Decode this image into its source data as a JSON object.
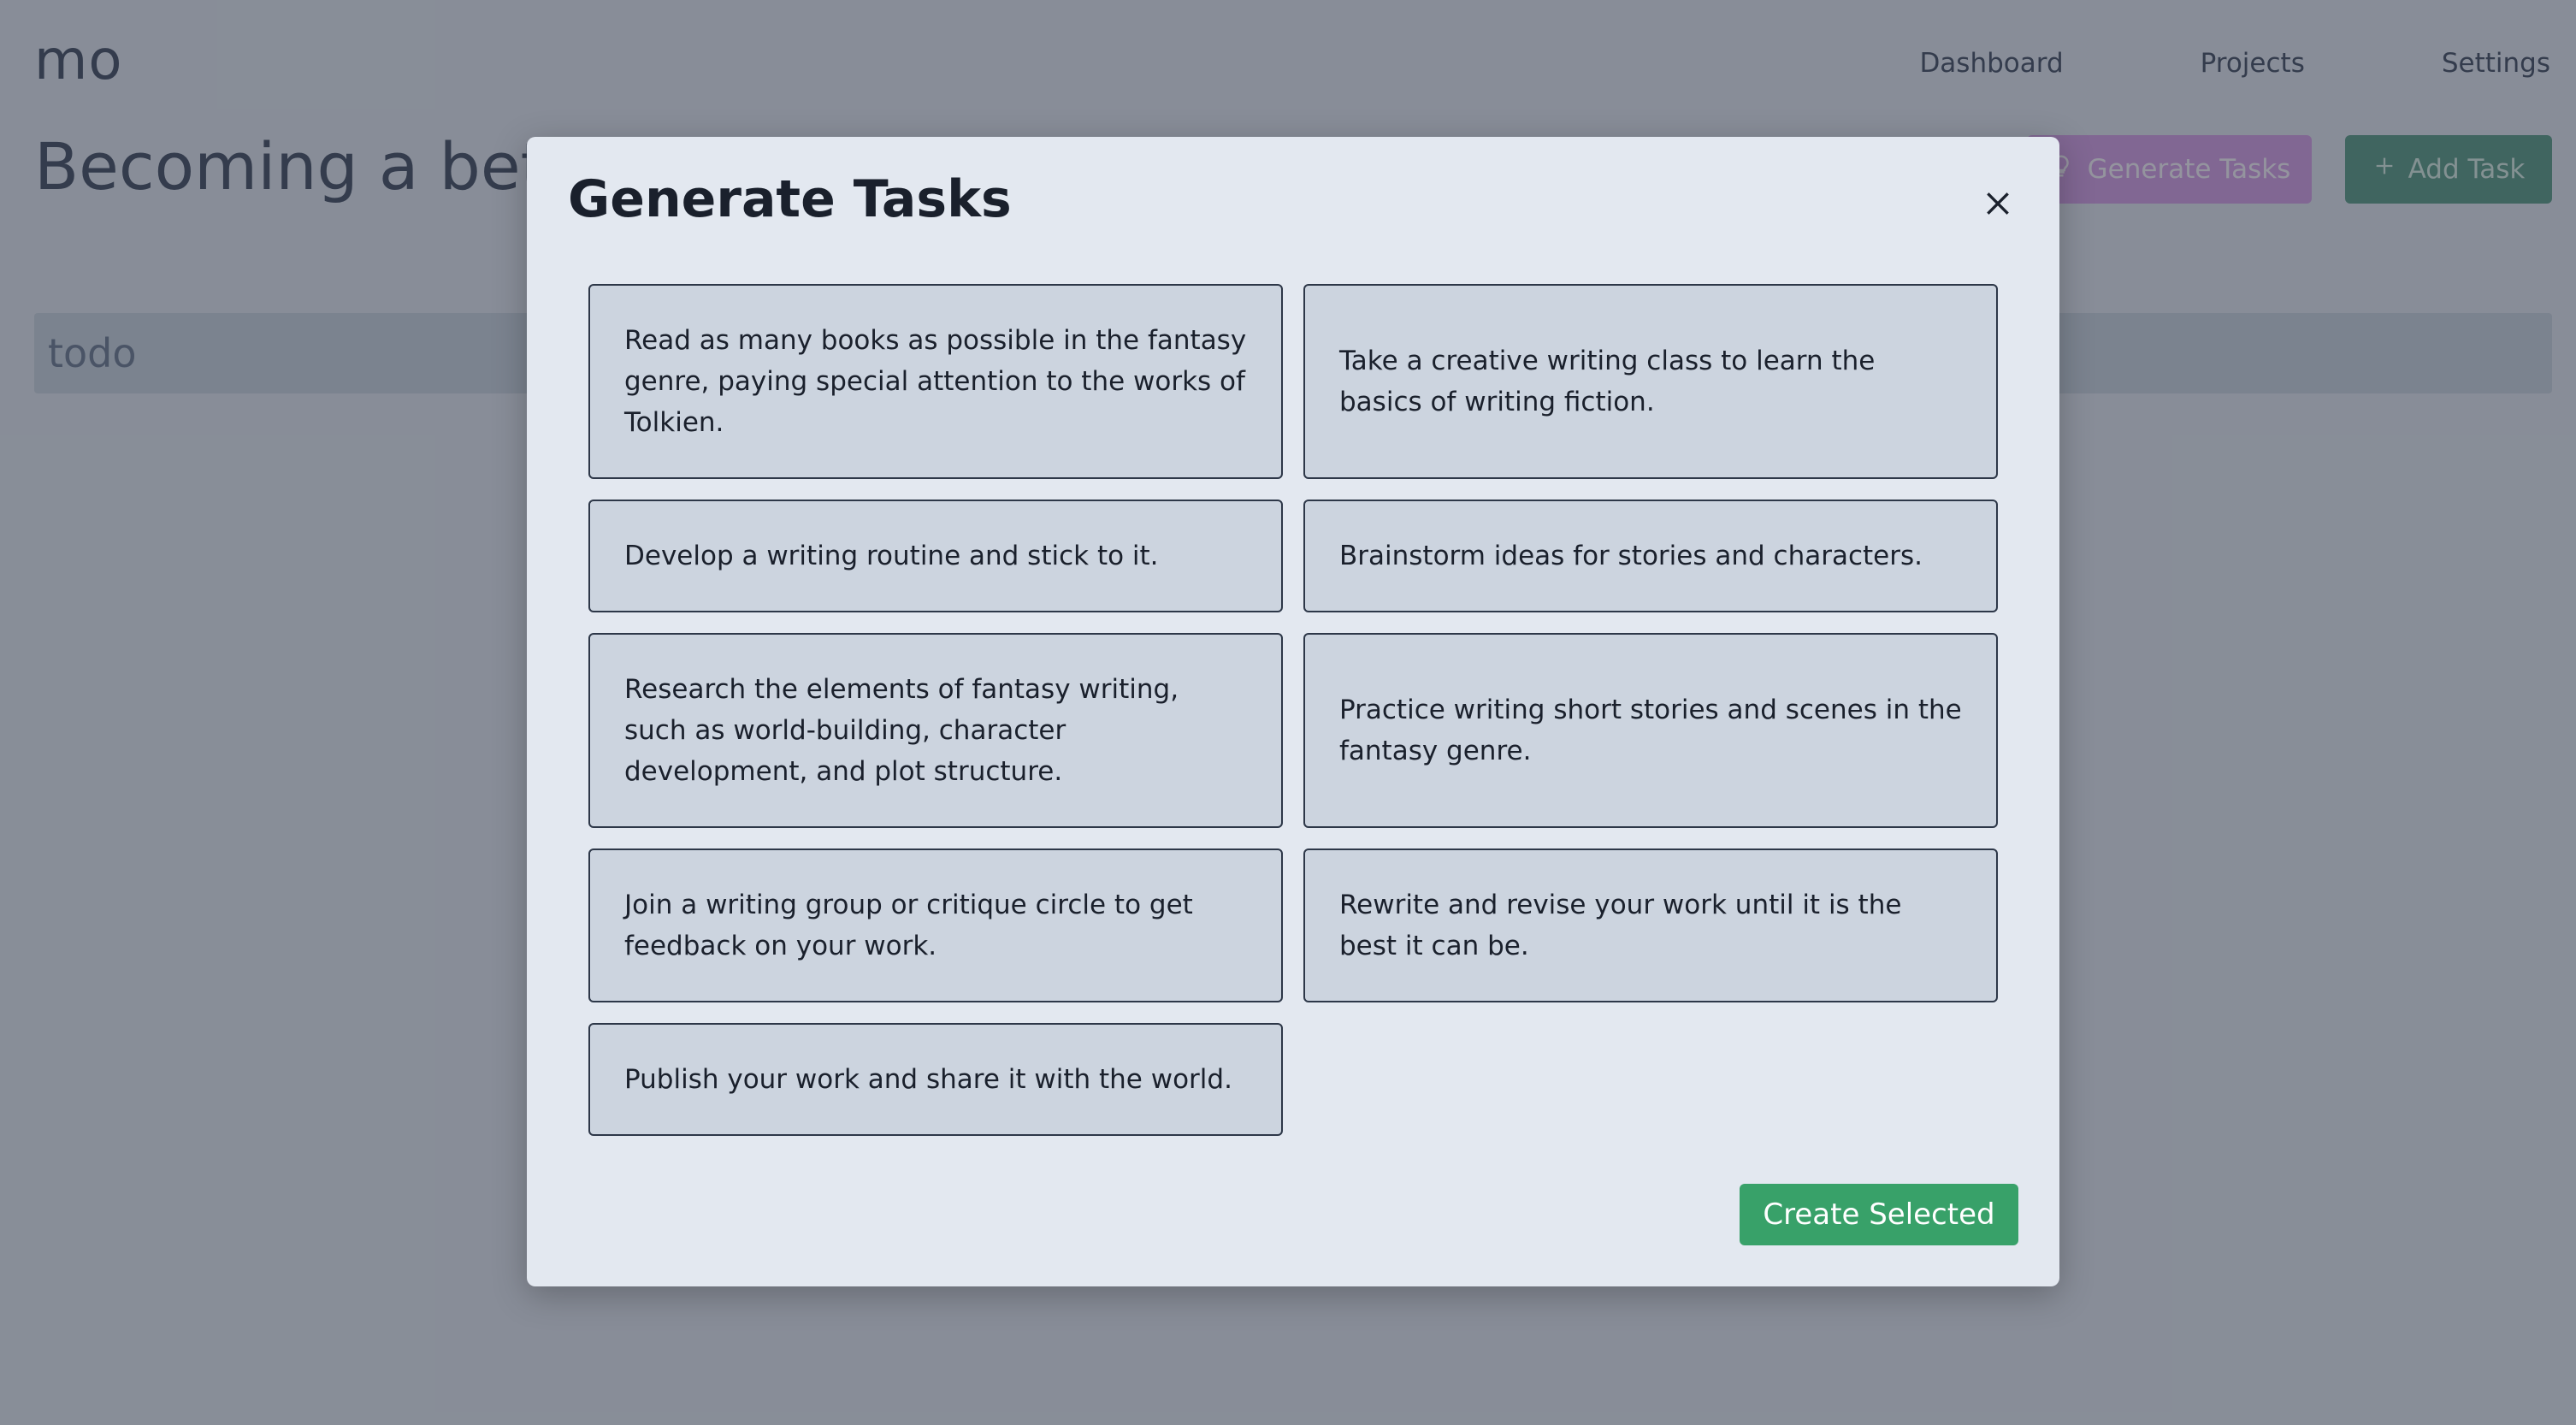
{
  "header": {
    "logo": "mo",
    "nav": [
      "Dashboard",
      "Projects",
      "Settings"
    ]
  },
  "project": {
    "title": "Becoming a better writer",
    "generate_label": "Generate Tasks",
    "add_label": "Add Task",
    "column_label": "todo"
  },
  "modal": {
    "title": "Generate Tasks",
    "tasks": [
      "Read as many books as possible in the fantasy genre, paying special attention to the works of Tolkien.",
      "Take a creative writing class to learn the basics of writing fiction.",
      "Develop a writing routine and stick to it.",
      "Brainstorm ideas for stories and characters.",
      "Research the elements of fantasy writing, such as world-building, character development, and plot structure.",
      "Practice writing short stories and scenes in the fantasy genre.",
      "Join a writing group or critique circle to get feedback on your work.",
      "Rewrite and revise your work until it is the best it can be.",
      "Publish your work and share it with the world."
    ],
    "create_label": "Create Selected"
  },
  "colors": {
    "accent_green": "#38a169",
    "generate_purple": "#d6a2e8",
    "overlay": "rgba(26,32,44,0.45)"
  }
}
